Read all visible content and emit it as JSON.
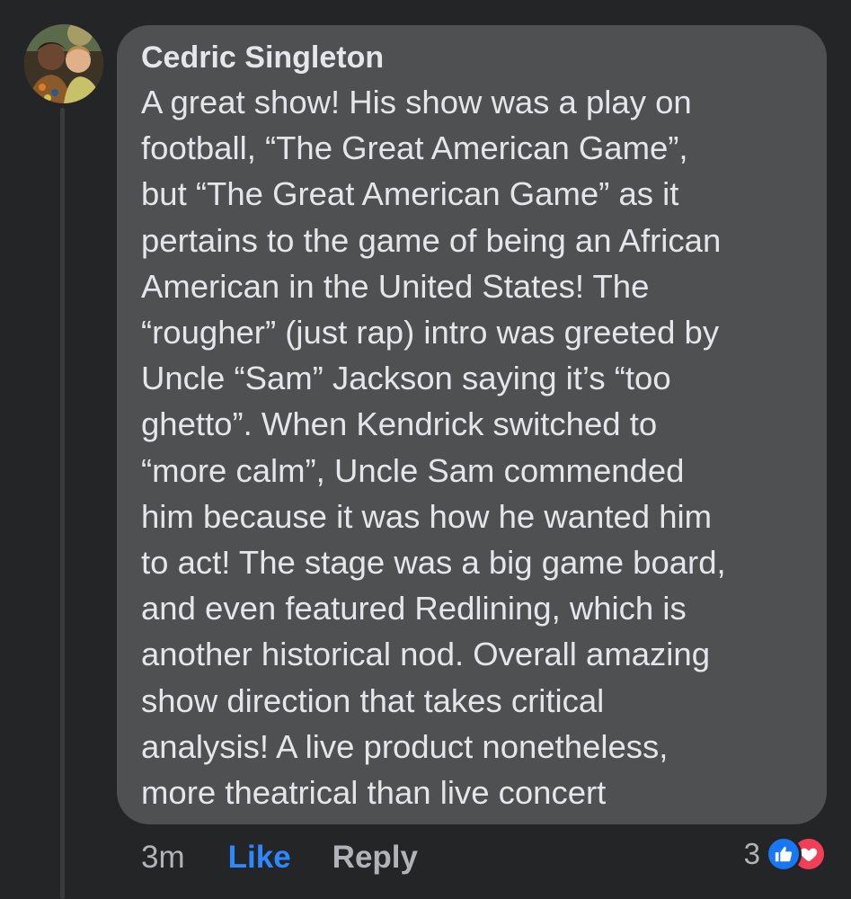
{
  "comment": {
    "author": "Cedric Singleton",
    "lines": [
      "A great show! His show was a play on",
      "football, “The Great American Game”,",
      "but “The Great American Game” as it",
      "pertains to the game of being an African",
      "American in the United States! The",
      "“rougher” (just rap) intro was greeted by",
      "Uncle “Sam” Jackson saying it’s “too",
      "ghetto”. When Kendrick switched to",
      "“more calm”, Uncle Sam commended",
      "him because it was how he wanted him",
      "to act! The stage was a big game board,",
      "and even featured Redlining, which is",
      "another historical nod. Overall amazing",
      "show direction that takes critical",
      "analysis! A live product nonetheless,",
      "more theatrical than live concert"
    ]
  },
  "actions": {
    "time": "3m",
    "like_label": "Like",
    "reply_label": "Reply"
  },
  "reactions": {
    "count": "3",
    "icons": [
      "like-icon",
      "love-icon"
    ],
    "like_color": "#1877f2",
    "love_color": "#f33e58"
  },
  "colors": {
    "background": "#242526",
    "bubble": "#4f5051",
    "text": "#e4e6eb",
    "muted": "#b0b3b8",
    "link": "#2d88ff"
  }
}
